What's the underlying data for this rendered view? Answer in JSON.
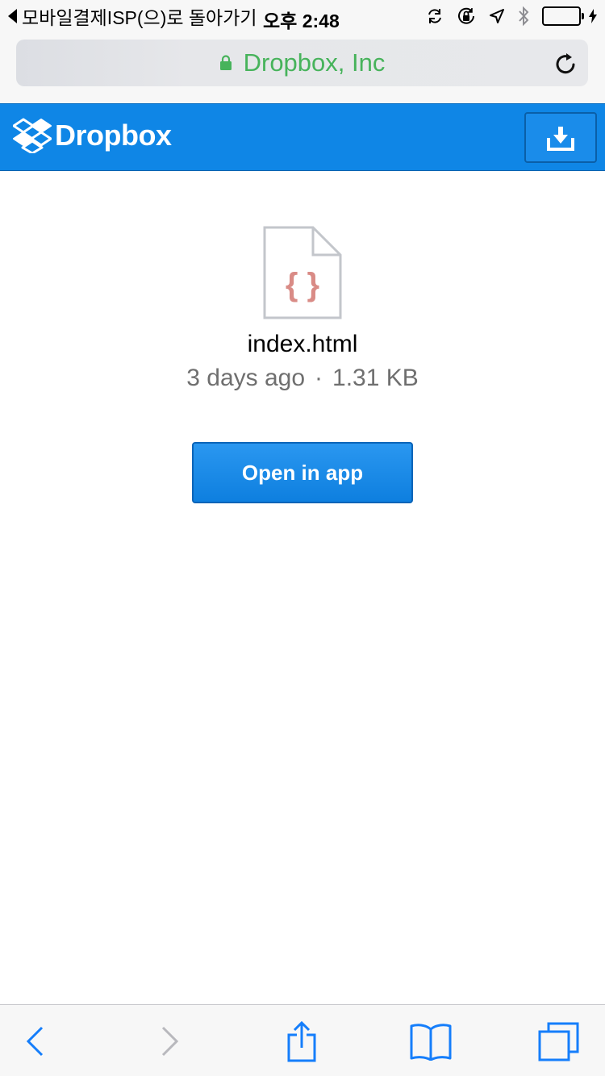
{
  "status_bar": {
    "back_label": "모바일결제ISP(으)로 돌아가기",
    "time": "오후 2:48",
    "icons": [
      "sync-icon",
      "orientation-lock-icon",
      "location-icon",
      "bluetooth-icon",
      "battery-icon",
      "charging-icon"
    ],
    "battery_color": "#4cd964"
  },
  "browser": {
    "url_text": "Dropbox, Inc",
    "url_color": "#47b35b",
    "secure_icon": "lock-icon",
    "reload_icon": "reload-icon"
  },
  "header": {
    "brand": "Dropbox",
    "brand_color": "#0f86e6",
    "download_icon": "download-icon"
  },
  "file": {
    "icon": "code-file-icon",
    "name": "index.html",
    "modified": "3 days ago",
    "separator": "·",
    "size": "1.31 KB"
  },
  "actions": {
    "open_in_app": "Open in app"
  },
  "toolbar": {
    "items": [
      "back-icon",
      "forward-icon",
      "share-icon",
      "bookmarks-icon",
      "tabs-icon"
    ],
    "tint_color": "#157efb"
  }
}
